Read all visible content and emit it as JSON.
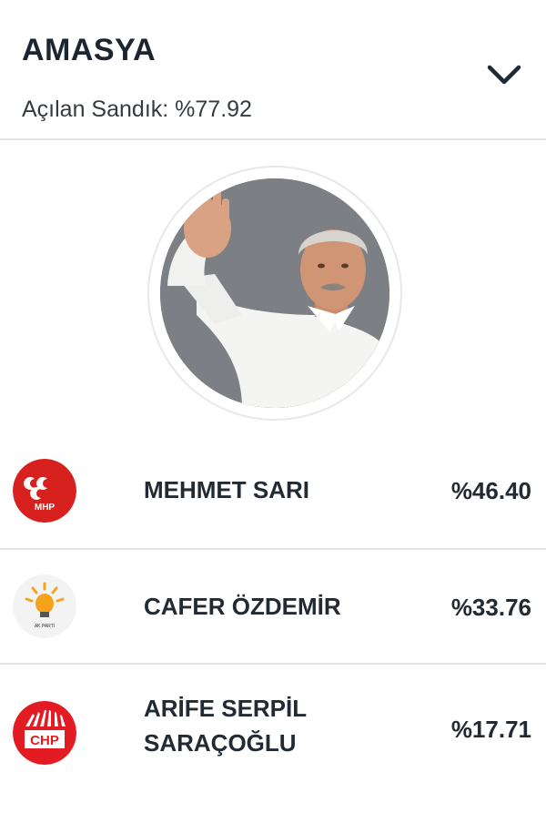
{
  "header": {
    "city": "AMASYA",
    "opened_label": "Açılan Sandık: %77.92",
    "toggle_icon": "chevron-down-icon"
  },
  "candidate_photo": {
    "description_icon": "candidate-photo",
    "background": "#7b7e82"
  },
  "candidates": [
    {
      "name_line1": "MEHMET SARI",
      "name_line2": "",
      "percent": "%46.40",
      "party_logo_text": "MHP",
      "party_color": "#d7211f"
    },
    {
      "name_line1": "CAFER ÖZDEMİR",
      "name_line2": "",
      "percent": "%33.76",
      "party_logo_text": "AK PARTİ",
      "party_color": "#f6a21b"
    },
    {
      "name_line1": "ARİFE SERPİL",
      "name_line2": "SARAÇOĞLU",
      "percent": "%17.71",
      "party_logo_text": "CHP",
      "party_color": "#e31b23"
    }
  ]
}
